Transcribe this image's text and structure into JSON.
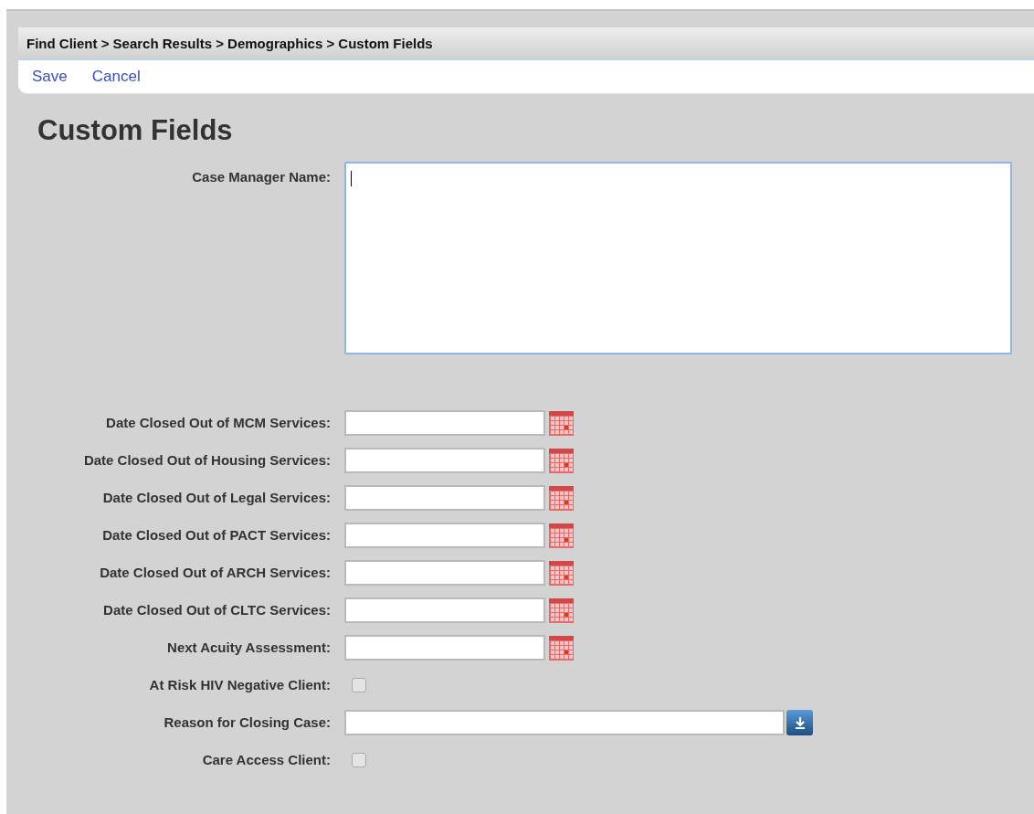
{
  "breadcrumb": "Find Client > Search Results > Demographics > Custom Fields",
  "toolbar": [
    "Save",
    "Cancel"
  ],
  "title": "Custom Fields",
  "fields": [
    {
      "kind": "textarea",
      "label": "Case Manager Name:",
      "focused": true
    },
    {
      "kind": "date",
      "label": "Date Closed Out of MCM Services:"
    },
    {
      "kind": "date",
      "label": "Date Closed Out of Housing Services:"
    },
    {
      "kind": "date",
      "label": "Date Closed Out of Legal Services:"
    },
    {
      "kind": "date",
      "label": "Date Closed Out of PACT Services:"
    },
    {
      "kind": "date",
      "label": "Date Closed Out of ARCH Services:"
    },
    {
      "kind": "date",
      "label": "Date Closed Out of CLTC Services:"
    },
    {
      "kind": "date",
      "label": "Next Acuity Assessment:"
    },
    {
      "kind": "checkbox",
      "label": "At Risk HIV Negative Client:",
      "checked": false
    },
    {
      "kind": "select",
      "label": "Reason for Closing Case:"
    },
    {
      "kind": "checkbox",
      "label": "Care Access Client:",
      "checked": false
    }
  ]
}
